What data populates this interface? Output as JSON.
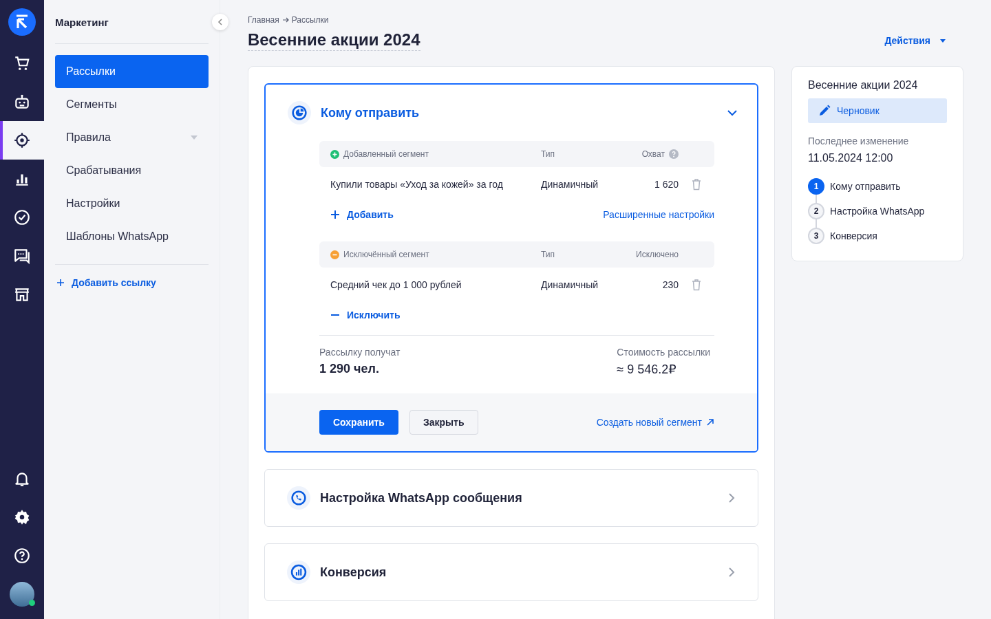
{
  "rail": {
    "top": [
      {
        "kind": "cart",
        "selected": false
      },
      {
        "kind": "robot",
        "selected": false
      },
      {
        "kind": "target",
        "selected": true
      },
      {
        "kind": "chart",
        "selected": false
      },
      {
        "kind": "check",
        "selected": false
      },
      {
        "kind": "chat",
        "selected": false
      },
      {
        "kind": "store",
        "selected": false
      }
    ],
    "bottom": [
      {
        "kind": "bell"
      },
      {
        "kind": "gear"
      },
      {
        "kind": "help"
      }
    ],
    "avatar": {
      "online": true
    }
  },
  "sidebar": {
    "title": "Маркетинг",
    "items": [
      {
        "label": "Рассылки",
        "selected": true,
        "has_submenu": false
      },
      {
        "label": "Сегменты",
        "selected": false,
        "has_submenu": false
      },
      {
        "label": "Правила",
        "selected": false,
        "has_submenu": true
      },
      {
        "label": "Срабатывания",
        "selected": false,
        "has_submenu": false
      },
      {
        "label": "Настройки",
        "selected": false,
        "has_submenu": false
      },
      {
        "label": "Шаблоны WhatsApp",
        "selected": false,
        "has_submenu": false
      }
    ],
    "add_link": "Добавить ссылку"
  },
  "breadcrumbs": [
    "Главная",
    "Рассылки"
  ],
  "title": "Весенние акции 2024",
  "actions": "Действия",
  "sections": [
    {
      "kind": "audience",
      "title": "Кому отправить",
      "expanded": true,
      "groups": [
        {
          "kind": "included",
          "columns": [
            "Добавленный сегмент",
            "Тип",
            "Охват"
          ],
          "rows": [
            {
              "name": "Купили товары «Уход за кожей» за год",
              "type": "Динамичный",
              "count": "1 620"
            }
          ],
          "action": "Добавить",
          "extra_link": "Расширенные настройки"
        },
        {
          "kind": "excluded",
          "columns": [
            "Исключённый сегмент",
            "Тип",
            "Исключено"
          ],
          "rows": [
            {
              "name": "Средний чек до 1 000 рублей",
              "type": "Динамичный",
              "count": "230"
            }
          ],
          "action": "Исключить"
        }
      ],
      "summary": [
        {
          "label": "Рассылку получат",
          "value": "1 290 чел."
        },
        {
          "label": "Стоимость рассылки",
          "value": "≈ 9 546.2₽"
        }
      ],
      "buttons": {
        "save": "Сохранить",
        "close": "Закрыть",
        "link": "Создать новый сегмент"
      }
    },
    {
      "kind": "whatsapp",
      "title": "Настройка WhatsApp сообщения",
      "expanded": false
    },
    {
      "kind": "conversion",
      "title": "Конверсия",
      "expanded": false
    }
  ],
  "status": {
    "title": "Весенние акции 2024",
    "badge": "Черновик",
    "changed_label": "Последнее изменение",
    "changed_value": "11.05.2024 12:00",
    "steps": [
      {
        "number": "1",
        "label": "Кому отправить",
        "selected": true
      },
      {
        "number": "2",
        "label": "Настройка WhatsApp",
        "selected": false
      },
      {
        "number": "3",
        "label": "Конверсия",
        "selected": false
      }
    ]
  }
}
